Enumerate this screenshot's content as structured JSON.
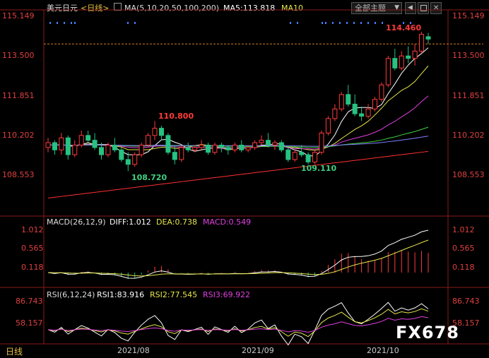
{
  "header": {
    "pair": "美元日元",
    "period_link": "<日线>",
    "ma_label": "MA(5,10,20,50,100,200)",
    "ma5_label": "MA5:113.818",
    "ma10_label": "MA10",
    "theme_label": "全部主题",
    "theme_arrow": "▼"
  },
  "price": {
    "ticks": [
      "115.149",
      "113.500",
      "111.851",
      "110.202",
      "108.553"
    ],
    "high_label": "110.800",
    "low_label": "108.720",
    "low2_label": "109.110",
    "last_label": "114.460"
  },
  "macd": {
    "title": "MACD(26,12,9)",
    "diff": "DIFF:1.012",
    "dea": "DEA:0.738",
    "macd": "MACD:0.549",
    "ticks": [
      "1.012",
      "0.565",
      "0.118"
    ]
  },
  "rsi": {
    "title": "RSI(6,12,24)",
    "rsi1": "RSI1:83.916",
    "rsi2": "RSI2:77.545",
    "rsi3": "RSI3:69.922",
    "ticks": [
      "86.743",
      "58.157"
    ]
  },
  "dates": [
    "2021/08",
    "2021/09",
    "2021/10"
  ],
  "footer": {
    "period": "日线"
  },
  "watermark": "FX678",
  "colors": {
    "up": "#ff3b3b",
    "down": "#26c281",
    "ma5": "#ffffff",
    "ma10": "#e6e64c",
    "ma20": "#e040e0",
    "ma50": "#40d040",
    "ma100": "#8080ff",
    "ma200": "#ff3030",
    "axis": "#e04040",
    "grid": "#8a1a1a"
  },
  "chart_data": {
    "type": "candlestick",
    "title": "美元日元 <日线>",
    "candles": [
      [
        109.7,
        110.1,
        109.5,
        109.9
      ],
      [
        109.9,
        110.0,
        109.4,
        109.6
      ],
      [
        109.6,
        110.3,
        109.4,
        110.1
      ],
      [
        110.1,
        110.2,
        109.2,
        109.4
      ],
      [
        109.4,
        110.0,
        109.3,
        109.8
      ],
      [
        109.8,
        110.4,
        109.7,
        110.2
      ],
      [
        110.2,
        110.4,
        109.9,
        110.0
      ],
      [
        110.0,
        110.3,
        109.6,
        109.7
      ],
      [
        109.7,
        109.9,
        109.2,
        109.4
      ],
      [
        109.4,
        109.9,
        109.3,
        109.8
      ],
      [
        109.8,
        110.1,
        109.5,
        109.6
      ],
      [
        109.6,
        109.7,
        109.1,
        109.2
      ],
      [
        109.2,
        109.5,
        108.72,
        109.0
      ],
      [
        109.0,
        109.5,
        108.9,
        109.4
      ],
      [
        109.4,
        109.9,
        109.3,
        109.8
      ],
      [
        109.8,
        110.3,
        109.7,
        110.2
      ],
      [
        110.2,
        110.8,
        110.0,
        110.5
      ],
      [
        110.5,
        110.6,
        110.0,
        110.2
      ],
      [
        110.2,
        110.3,
        109.4,
        109.5
      ],
      [
        109.5,
        109.8,
        109.0,
        109.2
      ],
      [
        109.2,
        109.8,
        109.1,
        109.7
      ],
      [
        109.7,
        109.9,
        109.5,
        109.6
      ],
      [
        109.6,
        109.8,
        109.5,
        109.7
      ],
      [
        109.7,
        110.0,
        109.6,
        109.8
      ],
      [
        109.8,
        109.9,
        109.4,
        109.5
      ],
      [
        109.5,
        109.9,
        109.4,
        109.8
      ],
      [
        109.8,
        109.9,
        109.5,
        109.7
      ],
      [
        109.7,
        109.8,
        109.4,
        109.6
      ],
      [
        109.6,
        109.9,
        109.5,
        109.8
      ],
      [
        109.8,
        110.0,
        109.5,
        109.6
      ],
      [
        109.6,
        109.8,
        109.5,
        109.7
      ],
      [
        109.7,
        110.0,
        109.6,
        109.9
      ],
      [
        109.9,
        110.2,
        109.8,
        110.0
      ],
      [
        110.0,
        110.3,
        109.7,
        109.8
      ],
      [
        109.8,
        110.0,
        109.6,
        109.9
      ],
      [
        109.9,
        110.0,
        109.5,
        109.6
      ],
      [
        109.6,
        109.7,
        109.1,
        109.2
      ],
      [
        109.2,
        109.6,
        109.11,
        109.5
      ],
      [
        109.5,
        109.8,
        109.3,
        109.4
      ],
      [
        109.4,
        109.5,
        109.0,
        109.1
      ],
      [
        109.1,
        109.6,
        109.0,
        109.5
      ],
      [
        109.5,
        110.4,
        109.4,
        110.3
      ],
      [
        110.3,
        111.0,
        110.2,
        110.9
      ],
      [
        110.9,
        111.5,
        110.8,
        111.3
      ],
      [
        111.3,
        112.0,
        111.2,
        111.9
      ],
      [
        111.9,
        112.3,
        111.4,
        111.5
      ],
      [
        111.5,
        111.9,
        111.0,
        111.1
      ],
      [
        111.1,
        111.4,
        110.8,
        111.0
      ],
      [
        111.0,
        111.5,
        110.9,
        111.3
      ],
      [
        111.3,
        111.8,
        111.2,
        111.7
      ],
      [
        111.7,
        112.4,
        111.6,
        112.3
      ],
      [
        112.3,
        113.5,
        112.2,
        113.4
      ],
      [
        113.4,
        113.8,
        112.9,
        113.0
      ],
      [
        113.0,
        113.7,
        112.9,
        113.5
      ],
      [
        113.5,
        113.9,
        113.2,
        113.4
      ],
      [
        113.4,
        114.0,
        113.1,
        113.7
      ],
      [
        113.7,
        114.5,
        113.6,
        114.4
      ],
      [
        114.3,
        114.46,
        114.0,
        114.2
      ]
    ],
    "ma5_last": 113.818,
    "annotations": {
      "high": 110.8,
      "low": 108.72,
      "low2": 109.11,
      "last": 114.46
    },
    "ylim": [
      107.9,
      115.8
    ],
    "ticks": [
      115.149,
      113.5,
      111.851,
      110.202,
      108.553
    ],
    "x_labels": [
      "2021/08",
      "2021/09",
      "2021/10"
    ],
    "macd": {
      "diff": 1.012,
      "dea": 0.738,
      "macd": 0.549,
      "ticks": [
        1.012,
        0.565,
        0.118
      ]
    },
    "rsi": {
      "rsi1": 83.916,
      "rsi2": 77.545,
      "rsi3": 69.922,
      "ticks": [
        86.743,
        58.157
      ]
    }
  }
}
